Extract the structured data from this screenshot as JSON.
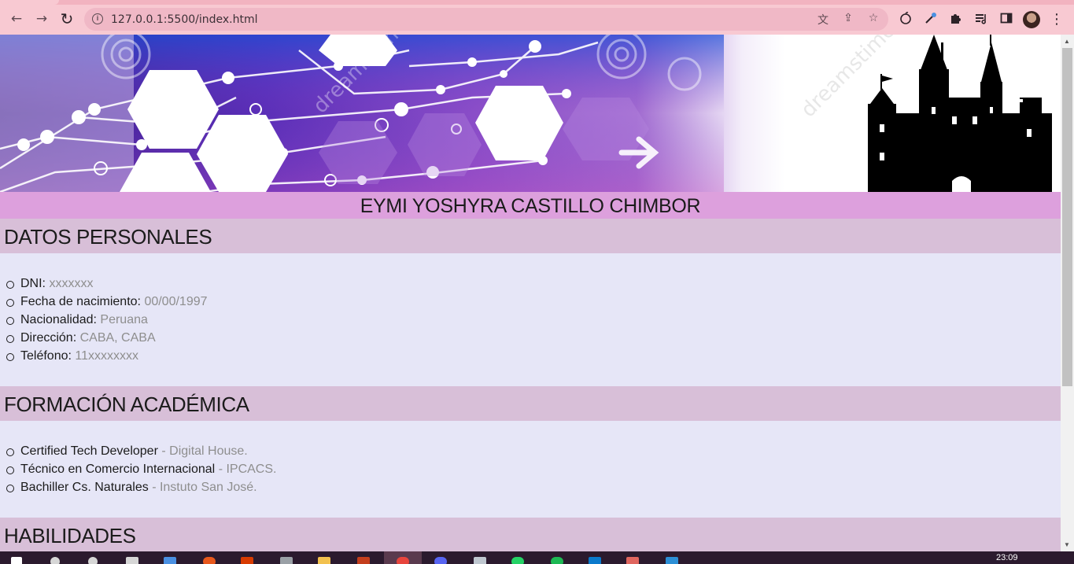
{
  "browser": {
    "url": "127.0.0.1:5500/index.html",
    "back_icon": "←",
    "forward_icon": "→",
    "reload_icon": "↻",
    "info_icon": "i",
    "translate_icon": "文",
    "share_icon": "⇪",
    "star_icon": "☆",
    "menu_icon": "⋮"
  },
  "banner": {
    "watermark": "dreamstime"
  },
  "header": {
    "name": "EYMI YOSHYRA CASTILLO CHIMBOR"
  },
  "datos": {
    "title": "DATOS PERSONALES",
    "items": [
      {
        "label": "DNI:",
        "value": "xxxxxxx"
      },
      {
        "label": "Fecha de nacimiento:",
        "value": "00/00/1997"
      },
      {
        "label": "Nacionalidad:",
        "value": "Peruana"
      },
      {
        "label": "Dirección:",
        "value": "CABA, CABA"
      },
      {
        "label": "Teléfono:",
        "value": "11xxxxxxxx"
      }
    ]
  },
  "formacion": {
    "title": "FORMACIÓN ACADÉMICA",
    "items": [
      {
        "label": "Certified Tech Developer",
        "value": "- Digital House."
      },
      {
        "label": "Técnico en Comercio Internacional",
        "value": "- IPCACS."
      },
      {
        "label": "Bachiller Cs. Naturales",
        "value": "- Instuto San José."
      }
    ]
  },
  "habilidades": {
    "title": "HABILIDADES"
  },
  "taskbar": {
    "time": "23:09"
  },
  "colors": {
    "name_bar": "#dda0dd",
    "section_header": "#d8bfd8",
    "section_body": "#e6e6f7",
    "value_text": "#8e8e8e"
  }
}
